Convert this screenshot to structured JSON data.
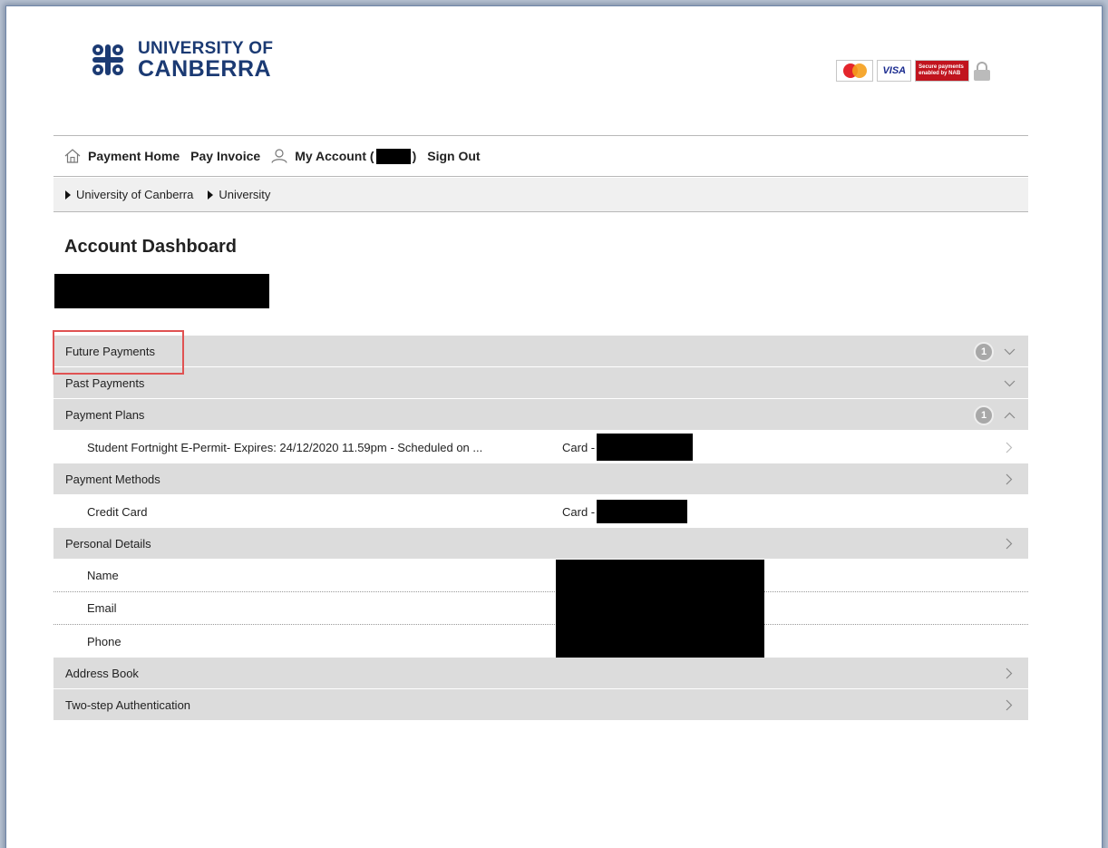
{
  "header": {
    "logo_line1": "UNIVERSITY OF",
    "logo_line2": "CANBERRA",
    "badges": {
      "mastercard": "mastercard",
      "visa": "VISA",
      "nab": "Secure payments enabled by NAB"
    }
  },
  "nav": {
    "home": "Payment Home",
    "pay_invoice": "Pay Invoice",
    "my_account_prefix": "My Account (",
    "my_account_suffix": ")",
    "sign_out": "Sign Out"
  },
  "breadcrumb": [
    "University of Canberra",
    "University"
  ],
  "page": {
    "title": "Account Dashboard"
  },
  "sections": {
    "future_payments": {
      "label": "Future Payments",
      "count": "1"
    },
    "past_payments": {
      "label": "Past Payments"
    },
    "payment_plans": {
      "label": "Payment Plans",
      "count": "1",
      "item": {
        "label": "Student Fortnight E-Permit- Expires: 24/12/2020 11.59pm - Scheduled on ...",
        "card_prefix": "Card - "
      }
    },
    "payment_methods": {
      "label": "Payment Methods",
      "item": {
        "label": "Credit Card",
        "card_prefix": "Card - "
      }
    },
    "personal_details": {
      "label": "Personal Details",
      "fields": [
        "Name",
        "Email",
        "Phone"
      ]
    },
    "address_book": {
      "label": "Address Book"
    },
    "two_step": {
      "label": "Two-step Authentication"
    }
  },
  "colors": {
    "brand": "#1b3a73",
    "section_bg": "#dcdcdc",
    "highlight": "#e05252",
    "badge": "#a8a8a8"
  }
}
